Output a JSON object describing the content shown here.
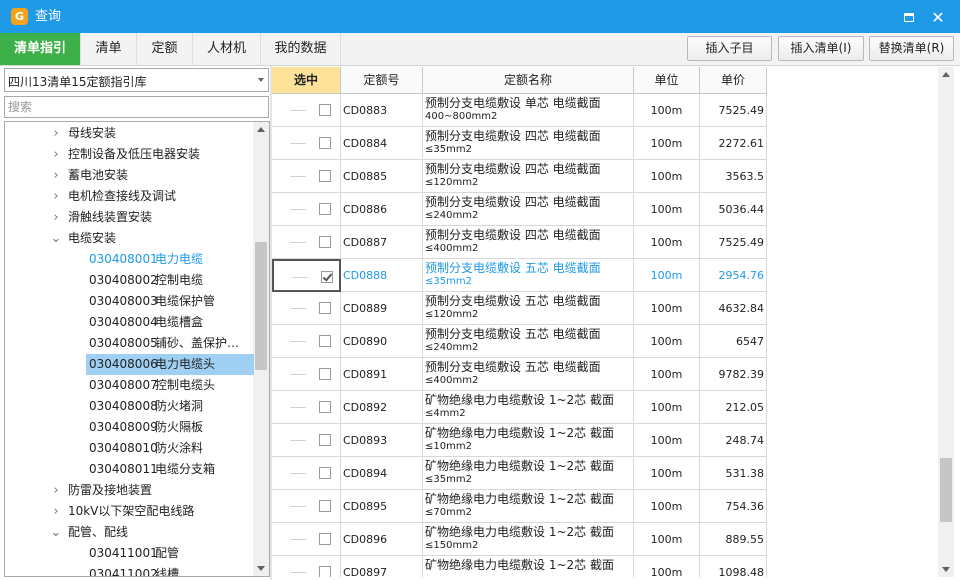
{
  "window": {
    "title": "查询",
    "logo_char": "G",
    "maximize_icon": "maximize-icon",
    "close_icon": "close-icon",
    "close_glyph": "✕"
  },
  "tabs": [
    {
      "label": "清单指引",
      "active": true
    },
    {
      "label": "清单"
    },
    {
      "label": "定额"
    },
    {
      "label": "人材机"
    },
    {
      "label": "我的数据"
    }
  ],
  "toolbar": {
    "insert_child": "插入子目",
    "insert_list": "插入清单(I)",
    "replace_list": "替换清单(R)"
  },
  "library_select": {
    "value": "四川13清单15定额指引库"
  },
  "search": {
    "placeholder": "搜索",
    "value": ""
  },
  "tree": {
    "items": [
      {
        "level": 1,
        "chevron": "›",
        "name": "母线安装"
      },
      {
        "level": 1,
        "chevron": "›",
        "name": "控制设备及低压电器安装"
      },
      {
        "level": 1,
        "chevron": "›",
        "name": "蓄电池安装"
      },
      {
        "level": 1,
        "chevron": "›",
        "name": "电机检查接线及调试"
      },
      {
        "level": 1,
        "chevron": "›",
        "name": "滑触线装置安装"
      },
      {
        "level": 1,
        "chevron": "⌄",
        "name": "电缆安装"
      },
      {
        "level": 2,
        "code": "030408001",
        "name": "电力电缆",
        "highlight": true
      },
      {
        "level": 2,
        "code": "030408002",
        "name": "控制电缆"
      },
      {
        "level": 2,
        "code": "030408003",
        "name": "电缆保护管"
      },
      {
        "level": 2,
        "code": "030408004",
        "name": "电缆槽盒"
      },
      {
        "level": 2,
        "code": "030408005",
        "name": "铺砂、盖保护…"
      },
      {
        "level": 2,
        "code": "030408006",
        "name": "电力电缆头",
        "selected": true
      },
      {
        "level": 2,
        "code": "030408007",
        "name": "控制电缆头"
      },
      {
        "level": 2,
        "code": "030408008",
        "name": "防火堵洞"
      },
      {
        "level": 2,
        "code": "030408009",
        "name": "防火隔板"
      },
      {
        "level": 2,
        "code": "030408010",
        "name": "防火涂料"
      },
      {
        "level": 2,
        "code": "030408011",
        "name": "电缆分支箱"
      },
      {
        "level": 1,
        "chevron": "›",
        "name": "防雷及接地装置"
      },
      {
        "level": 1,
        "chevron": "›",
        "name": "10kV以下架空配电线路"
      },
      {
        "level": 1,
        "chevron": "⌄",
        "name": "配管、配线"
      },
      {
        "level": 2,
        "code": "030411001",
        "name": "配管"
      },
      {
        "level": 2,
        "code": "030411002",
        "name": "线槽"
      }
    ]
  },
  "grid": {
    "columns": [
      "选中",
      "定额号",
      "定额名称",
      "单位",
      "单价"
    ],
    "rows": [
      {
        "code": "CD0883",
        "name": "预制分支电缆敷设 单芯 电缆截面",
        "sub": "400~800mm2",
        "unit": "100m",
        "price": "7525.49"
      },
      {
        "code": "CD0884",
        "name": "预制分支电缆敷设 四芯 电缆截面",
        "sub": "≤35mm2",
        "unit": "100m",
        "price": "2272.61"
      },
      {
        "code": "CD0885",
        "name": "预制分支电缆敷设 四芯 电缆截面",
        "sub": "≤120mm2",
        "unit": "100m",
        "price": "3563.5"
      },
      {
        "code": "CD0886",
        "name": "预制分支电缆敷设 四芯 电缆截面",
        "sub": "≤240mm2",
        "unit": "100m",
        "price": "5036.44"
      },
      {
        "code": "CD0887",
        "name": "预制分支电缆敷设 四芯 电缆截面",
        "sub": "≤400mm2",
        "unit": "100m",
        "price": "7525.49"
      },
      {
        "code": "CD0888",
        "name": "预制分支电缆敷设 五芯 电缆截面",
        "sub": "≤35mm2",
        "unit": "100m",
        "price": "2954.76",
        "checked": true,
        "current": true
      },
      {
        "code": "CD0889",
        "name": "预制分支电缆敷设 五芯 电缆截面",
        "sub": "≤120mm2",
        "unit": "100m",
        "price": "4632.84"
      },
      {
        "code": "CD0890",
        "name": "预制分支电缆敷设 五芯 电缆截面",
        "sub": "≤240mm2",
        "unit": "100m",
        "price": "6547"
      },
      {
        "code": "CD0891",
        "name": "预制分支电缆敷设 五芯 电缆截面",
        "sub": "≤400mm2",
        "unit": "100m",
        "price": "9782.39"
      },
      {
        "code": "CD0892",
        "name": "矿物绝缘电力电缆敷设 1~2芯 截面",
        "sub": "≤4mm2",
        "unit": "100m",
        "price": "212.05"
      },
      {
        "code": "CD0893",
        "name": "矿物绝缘电力电缆敷设 1~2芯 截面",
        "sub": "≤10mm2",
        "unit": "100m",
        "price": "248.74"
      },
      {
        "code": "CD0894",
        "name": "矿物绝缘电力电缆敷设 1~2芯 截面",
        "sub": "≤35mm2",
        "unit": "100m",
        "price": "531.38"
      },
      {
        "code": "CD0895",
        "name": "矿物绝缘电力电缆敷设 1~2芯 截面",
        "sub": "≤70mm2",
        "unit": "100m",
        "price": "754.36"
      },
      {
        "code": "CD0896",
        "name": "矿物绝缘电力电缆敷设 1~2芯 截面",
        "sub": "≤150mm2",
        "unit": "100m",
        "price": "889.55"
      },
      {
        "code": "CD0897",
        "name": "矿物绝缘电力电缆敷设 1~2芯 截面",
        "sub": "",
        "unit": "100m",
        "price": "1098.48"
      }
    ]
  },
  "colors": {
    "titlebar": "#1e9ae6",
    "tab_active": "#3eb04a",
    "selected_col_header": "#fde39a",
    "tree_selected": "#9fd0f3",
    "highlight_text": "#1e9ae6"
  }
}
